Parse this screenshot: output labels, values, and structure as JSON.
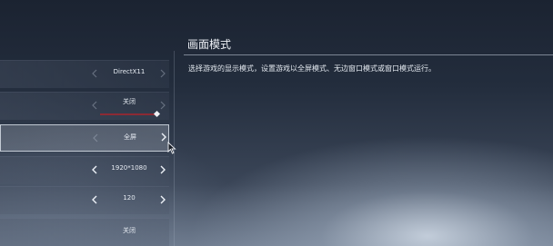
{
  "description": {
    "title": "画面模式",
    "text": "选择游戏的显示模式，设置游戏以全屏模式、无边窗口模式或窗口模式运行。"
  },
  "settings": [
    {
      "value": "DirectX11",
      "arrows": "dim"
    },
    {
      "value": "关闭",
      "arrows": "dim",
      "slider": true
    },
    {
      "value": "全屏",
      "arrows": "mixed",
      "selected": true
    },
    {
      "value": "1920*1080",
      "arrows": "bright"
    },
    {
      "value": "120",
      "arrows": "bright"
    },
    {
      "value": "关闭",
      "arrows": "none"
    }
  ],
  "colors": {
    "slider_track": "#962832",
    "highlight_border": "#e6ecf4"
  },
  "icons": {
    "prev": "chevron-left-icon",
    "next": "chevron-right-icon",
    "pointer": "mouse-cursor-icon"
  }
}
